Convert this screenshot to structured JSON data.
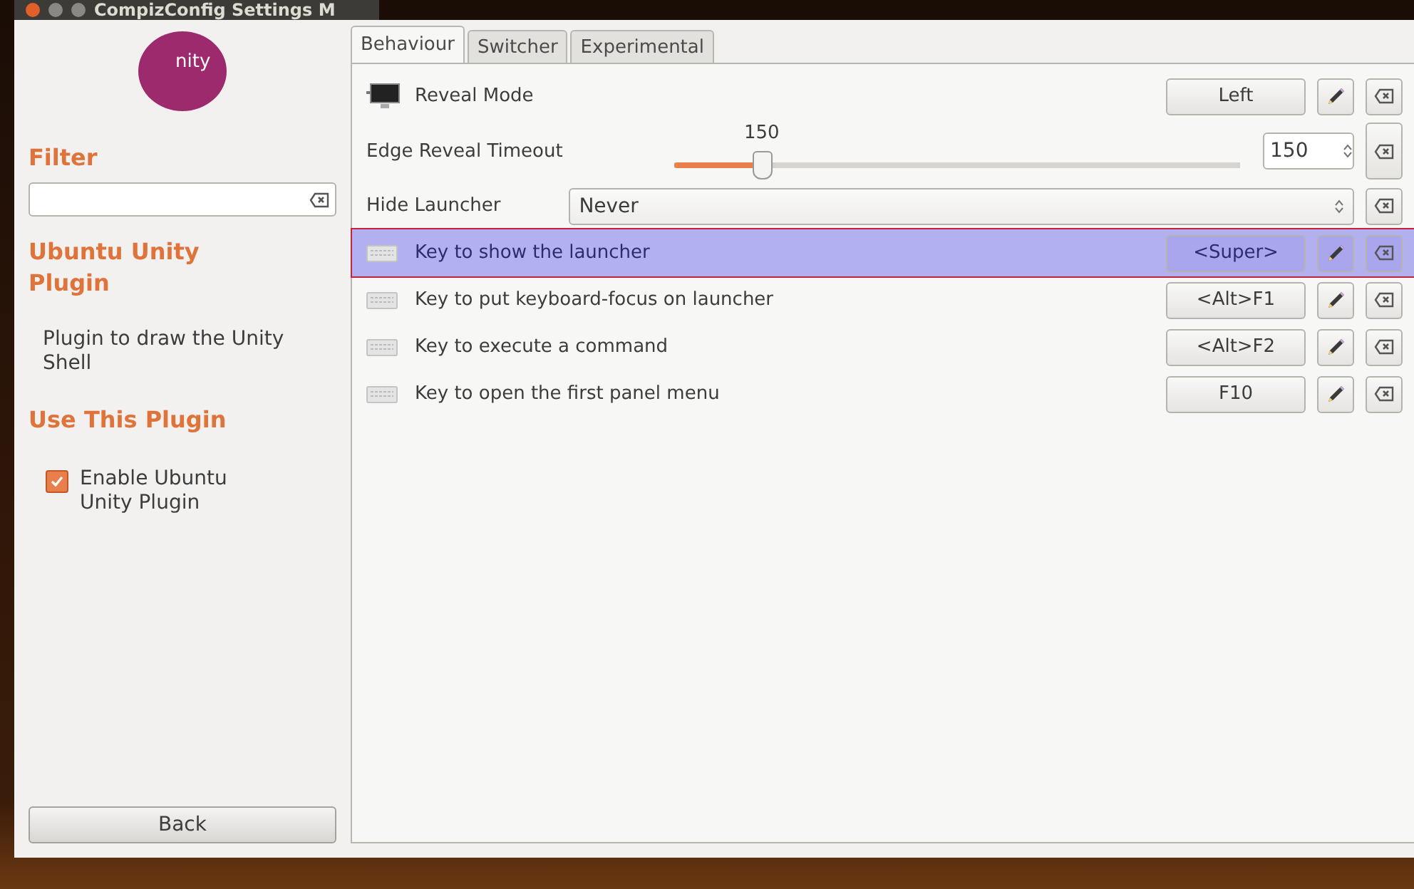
{
  "window": {
    "title": "CompizConfig Settings M"
  },
  "sidebar": {
    "filter_label": "Filter",
    "plugin_title": "Ubuntu Unity Plugin",
    "plugin_description": "Plugin to draw the Unity Shell",
    "use_title": "Use This Plugin",
    "enable": {
      "label": "Enable Ubuntu Unity Plugin",
      "checked": true
    },
    "back_button": "Back",
    "logo_text": "nity"
  },
  "tabs": [
    {
      "label": "Behaviour",
      "selected": true
    },
    {
      "label": "Switcher",
      "selected": false
    },
    {
      "label": "Experimental",
      "selected": false
    }
  ],
  "settings": [
    {
      "kind": "button",
      "label": "Reveal Mode",
      "value": "Left",
      "selected": false
    },
    {
      "kind": "slider",
      "label": "Edge Reveal Timeout",
      "reading": "150",
      "value": "150",
      "level": 0.155,
      "selected": false
    },
    {
      "kind": "combo",
      "label": "Hide Launcher",
      "value": "Never",
      "selected": false
    },
    {
      "kind": "button",
      "label": "Key to show the launcher",
      "value": "<Super>",
      "selected": true
    },
    {
      "kind": "button",
      "label": "Key to put keyboard-focus on launcher",
      "value": "<Alt>F1",
      "selected": false
    },
    {
      "kind": "button",
      "label": "Key to execute a command",
      "value": "<Alt>F2",
      "selected": false
    },
    {
      "kind": "button",
      "label": "Key to open the first panel menu",
      "value": "F10",
      "selected": false
    }
  ]
}
